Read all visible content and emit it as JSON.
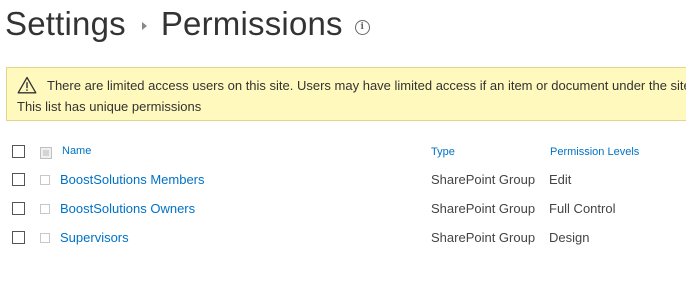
{
  "breadcrumb": {
    "parent": "Settings",
    "current": "Permissions",
    "info_icon": "info-icon"
  },
  "banner": {
    "icon": "warning-icon",
    "message": "There are limited access users on this site. Users may have limited access if an item or document under the site h",
    "note": "This list has unique permissions",
    "background": "#fff9bd"
  },
  "table": {
    "headers": {
      "name": "Name",
      "type": "Type",
      "permission_levels": "Permission Levels"
    },
    "rows": [
      {
        "name": "BoostSolutions Members",
        "type": "SharePoint Group",
        "permission": "Edit"
      },
      {
        "name": "BoostSolutions Owners",
        "type": "SharePoint Group",
        "permission": "Full Control"
      },
      {
        "name": "Supervisors",
        "type": "SharePoint Group",
        "permission": "Design"
      }
    ]
  },
  "colors": {
    "link": "#0072c6",
    "text": "#444444"
  }
}
